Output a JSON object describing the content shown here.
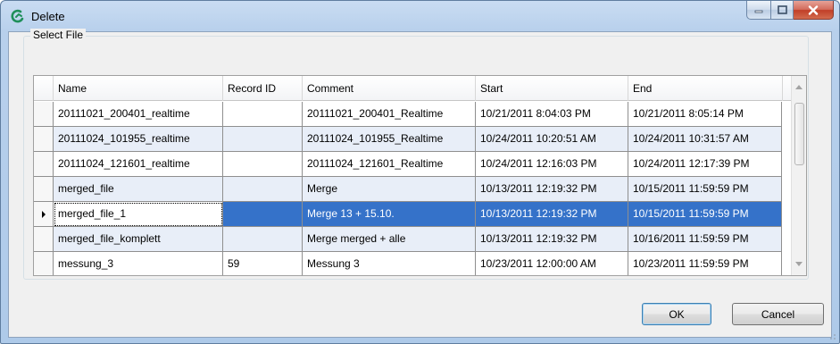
{
  "window": {
    "title": "Delete",
    "controls": {
      "minimize_icon": "minimize-icon",
      "maximize_icon": "maximize-icon",
      "close_icon": "close-icon"
    }
  },
  "group": {
    "label": "Select File"
  },
  "table": {
    "columns": [
      "Name",
      "Record ID",
      "Comment",
      "Start",
      "End"
    ],
    "rows": [
      {
        "name": "20111021_200401_realtime",
        "record_id": "",
        "comment": "20111021_200401_Realtime",
        "start": "10/21/2011 8:04:03 PM",
        "end": "10/21/2011 8:05:14 PM"
      },
      {
        "name": "20111024_101955_realtime",
        "record_id": "",
        "comment": "20111024_101955_Realtime",
        "start": "10/24/2011 10:20:51 AM",
        "end": "10/24/2011 10:31:57 AM"
      },
      {
        "name": "20111024_121601_realtime",
        "record_id": "",
        "comment": "20111024_121601_Realtime",
        "start": "10/24/2011 12:16:03 PM",
        "end": "10/24/2011 12:17:39 PM"
      },
      {
        "name": "merged_file",
        "record_id": "",
        "comment": "Merge",
        "start": "10/13/2011 12:19:32 PM",
        "end": "10/15/2011 11:59:59 PM"
      },
      {
        "name": "merged_file_1",
        "record_id": "",
        "comment": "Merge 13 + 15.10.",
        "start": "10/13/2011 12:19:32 PM",
        "end": "10/15/2011 11:59:59 PM"
      },
      {
        "name": "merged_file_komplett",
        "record_id": "",
        "comment": "Merge merged + alle",
        "start": "10/13/2011 12:19:32 PM",
        "end": "10/16/2011 11:59:59 PM"
      },
      {
        "name": "messung_3",
        "record_id": "59",
        "comment": "Messung 3",
        "start": "10/23/2011 12:00:00 AM",
        "end": "10/23/2011 11:59:59 PM"
      }
    ],
    "selected_row": 4
  },
  "buttons": {
    "ok": "OK",
    "cancel": "Cancel"
  },
  "colors": {
    "selection": "#3572c9",
    "alt_row": "#e8eef8",
    "title_bar": "#b8d0ec"
  }
}
